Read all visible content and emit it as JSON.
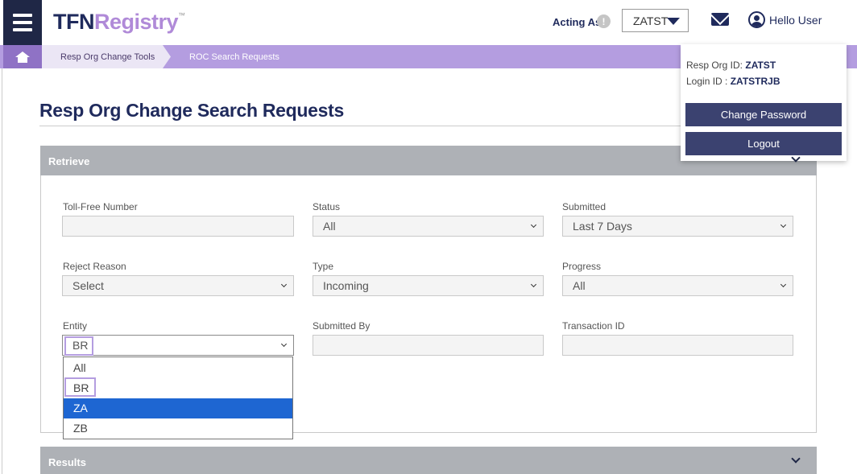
{
  "header": {
    "logo_main": "TFN",
    "logo_accent": "Registry",
    "logo_tm": "™",
    "acting_as_label": "Acting As",
    "info_glyph": "!",
    "acting_as_value": "ZATST",
    "hello_user": "Hello User"
  },
  "breadcrumb": {
    "items": [
      "Resp Org Change Tools",
      "ROC Search Requests"
    ]
  },
  "page": {
    "title": "Resp Org Change Search Requests"
  },
  "retrieve": {
    "title": "Retrieve",
    "fields": {
      "toll_free_number": {
        "label": "Toll-Free Number",
        "value": ""
      },
      "status": {
        "label": "Status",
        "value": "All"
      },
      "submitted": {
        "label": "Submitted",
        "value": "Last 7 Days"
      },
      "reject_reason": {
        "label": "Reject Reason",
        "value": "Select"
      },
      "type": {
        "label": "Type",
        "value": "Incoming"
      },
      "progress": {
        "label": "Progress",
        "value": "All"
      },
      "entity": {
        "label": "Entity",
        "value": "BR",
        "options": [
          "All",
          "BR",
          "ZA",
          "ZB"
        ],
        "highlighted": "ZA"
      },
      "submitted_by": {
        "label": "Submitted By",
        "value": ""
      },
      "transaction_id": {
        "label": "Transaction ID",
        "value": ""
      }
    }
  },
  "results": {
    "title": "Results"
  },
  "user_popup": {
    "resp_org_label": "Resp Org ID:",
    "resp_org_value": "ZATST",
    "login_label": "Login ID :",
    "login_value": "ZATSTRJB",
    "change_password": "Change Password",
    "logout": "Logout"
  },
  "colors": {
    "navy": "#1f2a5c",
    "lavender": "#b49de0",
    "panel_gray": "#aeb1b6",
    "highlight_blue": "#1e66d2"
  }
}
